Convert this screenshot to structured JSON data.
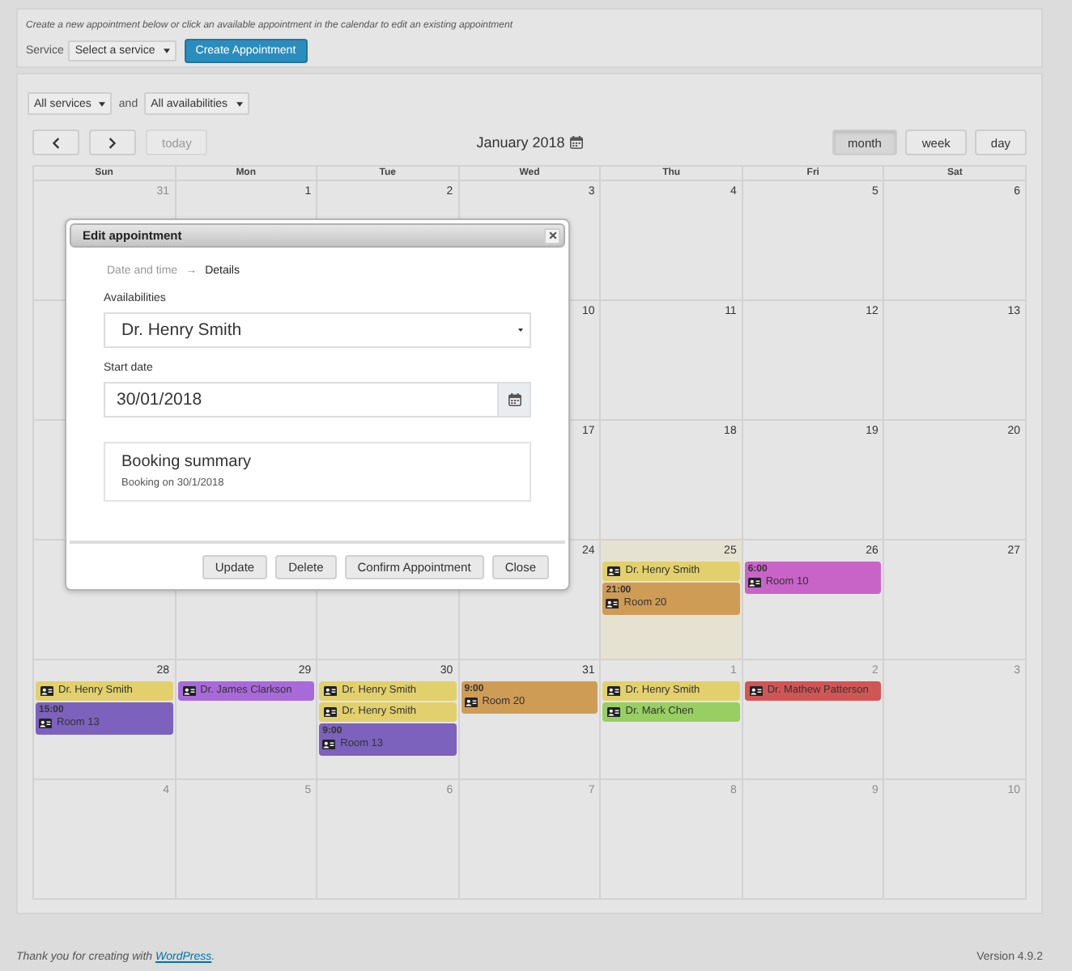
{
  "intro": {
    "text": "Create a new appointment below or click an available appointment in the calendar to edit an existing appointment",
    "service_label": "Service",
    "service_select": "Select a service",
    "create_button": "Create Appointment"
  },
  "filters": {
    "services_select": "All services",
    "joiner": "and",
    "availabilities_select": "All availabilities"
  },
  "toolbar": {
    "today": {
      "label": "today",
      "disabled": true
    },
    "title": "January 2018",
    "views": [
      {
        "label": "month",
        "selected": true
      },
      {
        "label": "week",
        "selected": false
      },
      {
        "label": "day",
        "selected": false
      }
    ]
  },
  "calendar": {
    "weekdays": [
      "Sun",
      "Mon",
      "Tue",
      "Wed",
      "Thu",
      "Fri",
      "Sat"
    ],
    "weeks": [
      {
        "days": [
          {
            "number": "31",
            "other_month": true,
            "today": false
          },
          {
            "number": "1",
            "other_month": false,
            "today": false
          },
          {
            "number": "2",
            "other_month": false,
            "today": false
          },
          {
            "number": "3",
            "other_month": false,
            "today": false
          },
          {
            "number": "4",
            "other_month": false,
            "today": false
          },
          {
            "number": "5",
            "other_month": false,
            "today": false
          },
          {
            "number": "6",
            "other_month": false,
            "today": false
          }
        ]
      },
      {
        "days": [
          {
            "number": "10",
            "other_month": false,
            "today": false
          },
          {
            "number": "11",
            "other_month": false,
            "today": false
          },
          {
            "number": "12",
            "other_month": false,
            "today": false
          },
          {
            "number": "13",
            "other_month": false,
            "today": false
          }
        ]
      },
      {
        "days": [
          {
            "number": "17",
            "other_month": false,
            "today": false
          },
          {
            "number": "18",
            "other_month": false,
            "today": false
          },
          {
            "number": "19",
            "other_month": false,
            "today": false
          },
          {
            "number": "20",
            "other_month": false,
            "today": false
          }
        ]
      },
      {
        "days": [
          {
            "number": "24",
            "other_month": false,
            "today": false
          },
          {
            "number": "25",
            "other_month": false,
            "today": true,
            "events": [
              {
                "title": "Dr. Henry Smith",
                "color": "#e2d06c"
              },
              {
                "time": "21:00",
                "title": "Room 20",
                "color": "#cf9c56"
              }
            ]
          },
          {
            "number": "26",
            "other_month": false,
            "today": false,
            "events": [
              {
                "time": "6:00",
                "title": "Room 10",
                "color": "#c864c8"
              }
            ]
          },
          {
            "number": "27",
            "other_month": false,
            "today": false
          }
        ]
      },
      {
        "days": [
          {
            "number": "28",
            "other_month": false,
            "today": false,
            "events": [
              {
                "title": "Dr. Henry Smith",
                "color": "#e2d06c"
              },
              {
                "time": "15:00",
                "title": "Room 13",
                "color": "#7c62bd"
              }
            ]
          },
          {
            "number": "29",
            "other_month": false,
            "today": false,
            "events": [
              {
                "title": "Dr. James Clarkson",
                "color": "#a86ad9"
              }
            ]
          },
          {
            "number": "30",
            "other_month": false,
            "today": false,
            "events": [
              {
                "title": "Dr. Henry Smith",
                "color": "#e2d06c"
              },
              {
                "title": "Dr. Henry Smith",
                "color": "#e2d06c"
              },
              {
                "time": "9:00",
                "title": "Room 13",
                "color": "#7c62bd"
              }
            ]
          },
          {
            "number": "31",
            "other_month": false,
            "today": false,
            "events": [
              {
                "time": "9:00",
                "title": "Room 20",
                "color": "#cf9c56"
              }
            ]
          },
          {
            "number": "1",
            "other_month": true,
            "today": false,
            "events": [
              {
                "title": "Dr. Henry Smith",
                "color": "#e2d06c"
              },
              {
                "title": "Dr. Mark Chen",
                "color": "#98cf62"
              }
            ]
          },
          {
            "number": "2",
            "other_month": true,
            "today": false,
            "events": [
              {
                "title": "Dr. Mathew Patterson",
                "color": "#d05656"
              }
            ]
          },
          {
            "number": "3",
            "other_month": true,
            "today": false
          }
        ]
      },
      {
        "days": [
          {
            "number": "4",
            "other_month": true,
            "today": false
          },
          {
            "number": "5",
            "other_month": true,
            "today": false
          },
          {
            "number": "6",
            "other_month": true,
            "today": false
          },
          {
            "number": "7",
            "other_month": true,
            "today": false
          },
          {
            "number": "8",
            "other_month": true,
            "today": false
          },
          {
            "number": "9",
            "other_month": true,
            "today": false
          },
          {
            "number": "10",
            "other_month": true,
            "today": false
          }
        ]
      }
    ]
  },
  "dialog": {
    "title": "Edit appointment",
    "steps": [
      {
        "label": "Date and time",
        "selected": false
      },
      {
        "label": "Details",
        "selected": true
      }
    ],
    "step_separator": "→",
    "availability_label": "Availabilities",
    "availability_value": "Dr. Henry Smith",
    "start_date_label": "Start date",
    "start_date_value": "30/01/2018",
    "summary_title": "Booking summary",
    "summary_text": "Booking on 30/1/2018",
    "buttons": [
      "Update",
      "Delete",
      "Confirm Appointment",
      "Close"
    ]
  },
  "footer": {
    "credit": "Thank you for creating with",
    "credit_link": "WordPress",
    "credit_end": ".",
    "version": "Version 4.9.2"
  }
}
